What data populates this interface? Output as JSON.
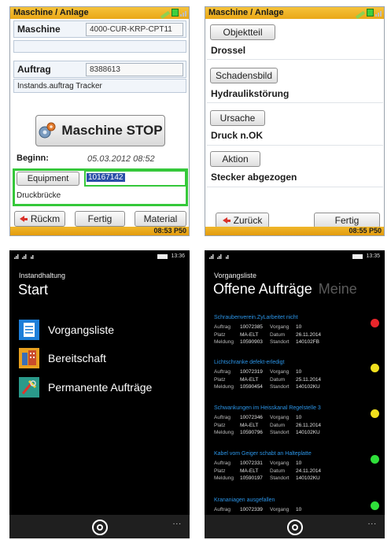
{
  "panel1": {
    "title": "Maschine / Anlage",
    "maschine_label": "Maschine",
    "maschine_value": "4000-CUR-KRP-CPT11",
    "auftrag_label": "Auftrag",
    "auftrag_value": "8388613",
    "auftrag_desc": "Instands.auftrag Tracker",
    "stop_button": "Maschine STOP",
    "beginn_label": "Beginn:",
    "beginn_value": "05.03.2012 08:52",
    "equipment_button": "Equipment",
    "equipment_value": "10167142",
    "equipment_desc": "Druckbrücke",
    "btn_rueckm": "Rückm",
    "btn_fertig": "Fertig",
    "btn_material": "Material",
    "status": "08:53 P50"
  },
  "panel2": {
    "title": "Maschine / Anlage",
    "btn_objektteil": "Objektteil",
    "val_objektteil": "Drossel",
    "btn_schadensbild": "Schadensbild",
    "val_schadensbild": "Hydraulikstörung",
    "btn_ursache": "Ursache",
    "val_ursache": "Druck n.OK",
    "btn_aktion": "Aktion",
    "val_aktion": "Stecker abgezogen",
    "btn_zurueck": "Zurück",
    "btn_fertig": "Fertig",
    "status": "08:55 P50"
  },
  "panel3": {
    "time": "13:36",
    "subtitle": "Instandhaltung",
    "title": "Start",
    "items": [
      {
        "label": "Vorgangsliste",
        "icon": "list-icon"
      },
      {
        "label": "Bereitschaft",
        "icon": "building-icon"
      },
      {
        "label": "Permanente Aufträge",
        "icon": "tools-icon"
      }
    ],
    "menu_dots": "..."
  },
  "panel4": {
    "time": "13:35",
    "subtitle": "Vorgangsliste",
    "title": "Offene Aufträge",
    "ghost_title": "Meine",
    "menu_dots": "...",
    "labels": {
      "auftrag": "Auftrag",
      "vorgang": "Vorgang",
      "platz": "Platz",
      "datum": "Datum",
      "meldung": "Meldung",
      "standort": "Standort"
    },
    "tasks": [
      {
        "title": "Schraubenverein.ZyLarbeitet nicht",
        "auftrag": "10072385",
        "vorgang": "10",
        "platz": "MA-ELT",
        "datum": "26.11.2014",
        "meldung": "10590903",
        "standort": "140102FB",
        "status_color": "#e8262b"
      },
      {
        "title": "Lichtschranke defekt-erledigt",
        "auftrag": "10072319",
        "vorgang": "10",
        "platz": "MA-ELT",
        "datum": "25.11.2014",
        "meldung": "10590454",
        "standort": "140102KU",
        "status_color": "#f1e01e"
      },
      {
        "title": "Schwankungen im Heisskanal Regelstelle 3",
        "auftrag": "10072346",
        "vorgang": "10",
        "platz": "MA-ELT",
        "datum": "26.11.2014",
        "meldung": "10590796",
        "standort": "140102KU",
        "status_color": "#f1e01e"
      },
      {
        "title": "Kabel vom Geiger schabt an Halteplatte",
        "auftrag": "10072331",
        "vorgang": "10",
        "platz": "MA-ELT",
        "datum": "24.11.2014",
        "meldung": "10590197",
        "standort": "140102KU",
        "status_color": "#2fe03a"
      },
      {
        "title": "Krananiagen ausgefallen",
        "auftrag": "10072339",
        "vorgang": "10",
        "status_color": "#2fe03a"
      }
    ]
  }
}
